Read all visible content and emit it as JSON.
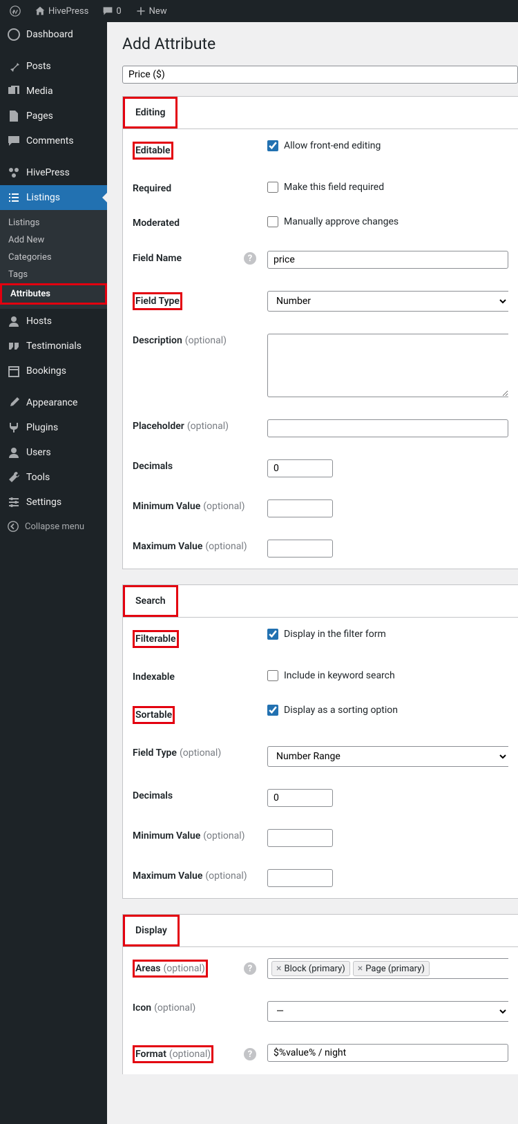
{
  "topbar": {
    "site_name": "HivePress",
    "comments_count": "0",
    "new_label": "New"
  },
  "sidebar": {
    "dashboard": "Dashboard",
    "posts": "Posts",
    "media": "Media",
    "pages": "Pages",
    "comments": "Comments",
    "hivepress": "HivePress",
    "listings": "Listings",
    "listings_sub": [
      "Listings",
      "Add New",
      "Categories",
      "Tags",
      "Attributes"
    ],
    "hosts": "Hosts",
    "testimonials": "Testimonials",
    "bookings": "Bookings",
    "appearance": "Appearance",
    "plugins": "Plugins",
    "users": "Users",
    "tools": "Tools",
    "settings": "Settings",
    "collapse": "Collapse menu"
  },
  "page": {
    "heading": "Add Attribute",
    "title_value": "Price ($)"
  },
  "editing": {
    "title": "Editing",
    "editable": {
      "label": "Editable",
      "chk": "Allow front-end editing"
    },
    "required": {
      "label": "Required",
      "chk": "Make this field required"
    },
    "moderated": {
      "label": "Moderated",
      "chk": "Manually approve changes"
    },
    "field_name": {
      "label": "Field Name",
      "value": "price"
    },
    "field_type": {
      "label": "Field Type",
      "value": "Number"
    },
    "description": {
      "label": "Description",
      "opt": "(optional)"
    },
    "placeholder": {
      "label": "Placeholder",
      "opt": "(optional)"
    },
    "decimals": {
      "label": "Decimals",
      "value": "0"
    },
    "min": {
      "label": "Minimum Value",
      "opt": "(optional)"
    },
    "max": {
      "label": "Maximum Value",
      "opt": "(optional)"
    }
  },
  "search": {
    "title": "Search",
    "filterable": {
      "label": "Filterable",
      "chk": "Display in the filter form"
    },
    "indexable": {
      "label": "Indexable",
      "chk": "Include in keyword search"
    },
    "sortable": {
      "label": "Sortable",
      "chk": "Display as a sorting option"
    },
    "field_type": {
      "label": "Field Type",
      "opt": "(optional)",
      "value": "Number Range"
    },
    "decimals": {
      "label": "Decimals",
      "value": "0"
    },
    "min": {
      "label": "Minimum Value",
      "opt": "(optional)"
    },
    "max": {
      "label": "Maximum Value",
      "opt": "(optional)"
    }
  },
  "display": {
    "title": "Display",
    "areas": {
      "label": "Areas",
      "opt": "(optional)",
      "tags": [
        "Block (primary)",
        "Page (primary)"
      ]
    },
    "icon": {
      "label": "Icon",
      "opt": "(optional)",
      "value": "—"
    },
    "format": {
      "label": "Format",
      "opt": "(optional)",
      "value": "$%value% / night"
    }
  }
}
